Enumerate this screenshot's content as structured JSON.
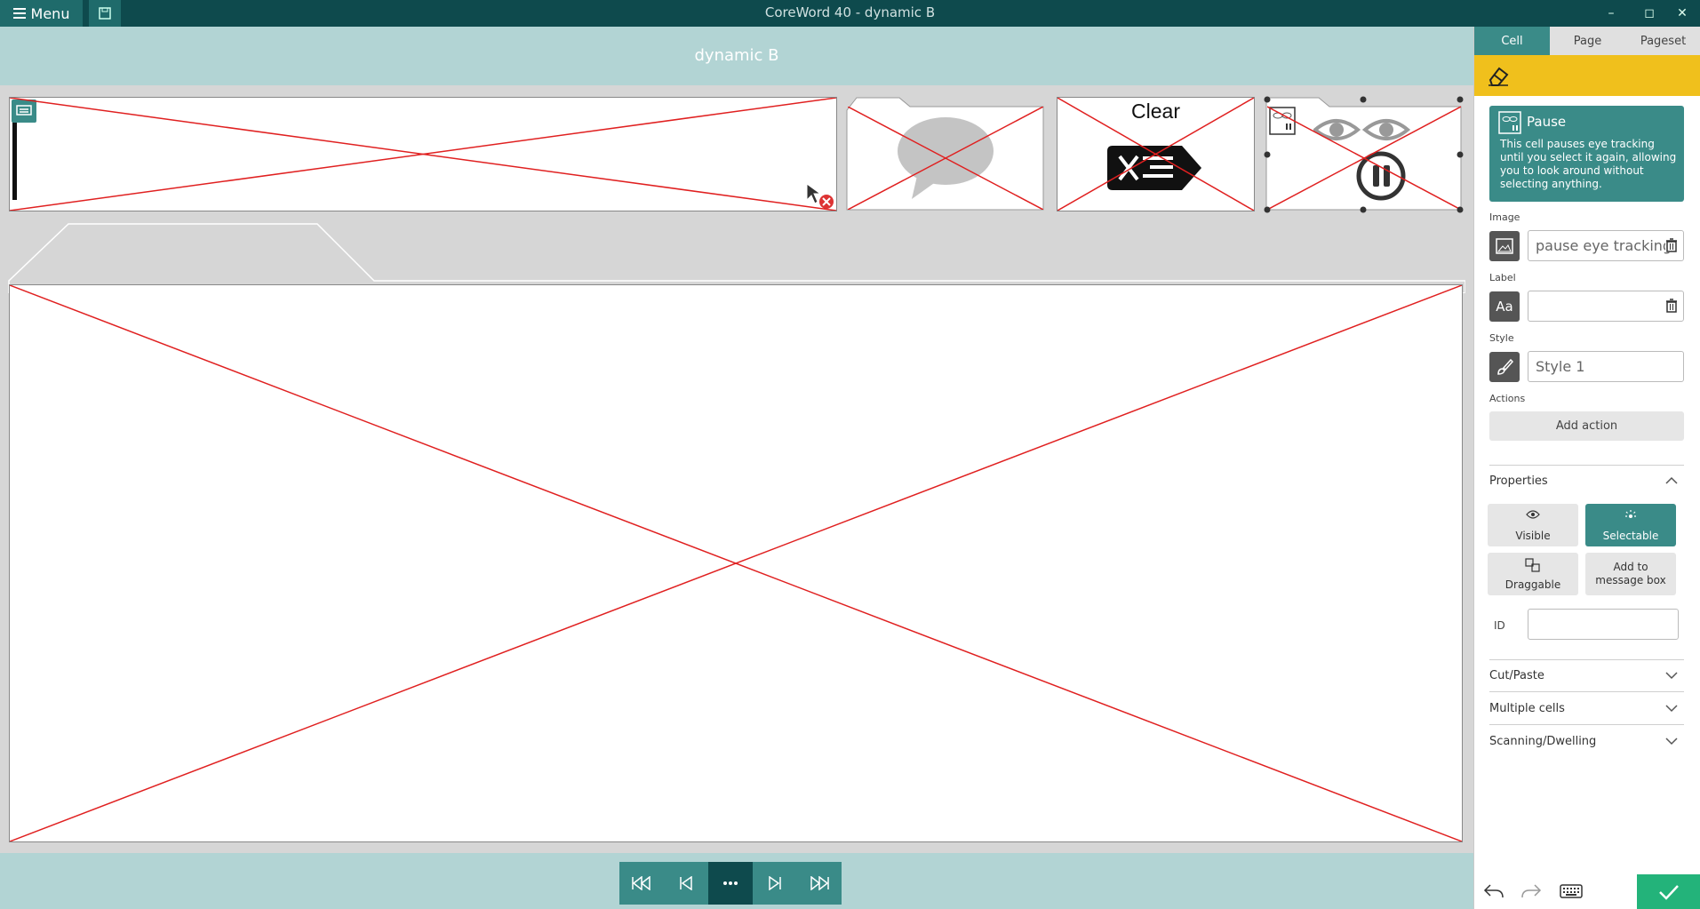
{
  "titlebar": {
    "menu_label": "Menu",
    "window_title": "CoreWord 40 - dynamic B",
    "controls": [
      "minimize-icon",
      "maximize-icon",
      "close-icon"
    ]
  },
  "page": {
    "title": "dynamic B"
  },
  "cells": {
    "message": {
      "label": ""
    },
    "speak": {
      "label": ""
    },
    "clear": {
      "label": "Clear"
    },
    "pause": {
      "label": ""
    }
  },
  "bottom_nav": {
    "buttons": [
      "first-page-icon",
      "previous-page-icon",
      "more-icon",
      "next-page-icon",
      "last-page-icon"
    ]
  },
  "panel": {
    "tabs": [
      "Cell",
      "Page",
      "Pageset"
    ],
    "active_tab": "Cell",
    "info": {
      "title": "Pause",
      "description": "This cell pauses eye tracking until you select it again, allowing you to look around without selecting anything."
    },
    "image_label": "Image",
    "image_value": "pause eye tracking",
    "label_label": "Label",
    "label_value": "",
    "style_label": "Style",
    "style_value": "Style 1",
    "actions_label": "Actions",
    "add_action": "Add action",
    "properties_title": "Properties",
    "properties": {
      "visible": "Visible",
      "selectable": "Selectable",
      "draggable": "Draggable",
      "add_to_message": "Add to message box"
    },
    "id_label": "ID",
    "id_value": "",
    "sections": [
      "Cut/Paste",
      "Multiple cells",
      "Scanning/Dwelling"
    ]
  },
  "colors": {
    "teal_dark": "#0e4a4d",
    "teal": "#3a8b88",
    "teal_light": "#b2d4d4",
    "yellow": "#f0c01c",
    "green": "#23b37a",
    "error_red": "#e02020"
  }
}
